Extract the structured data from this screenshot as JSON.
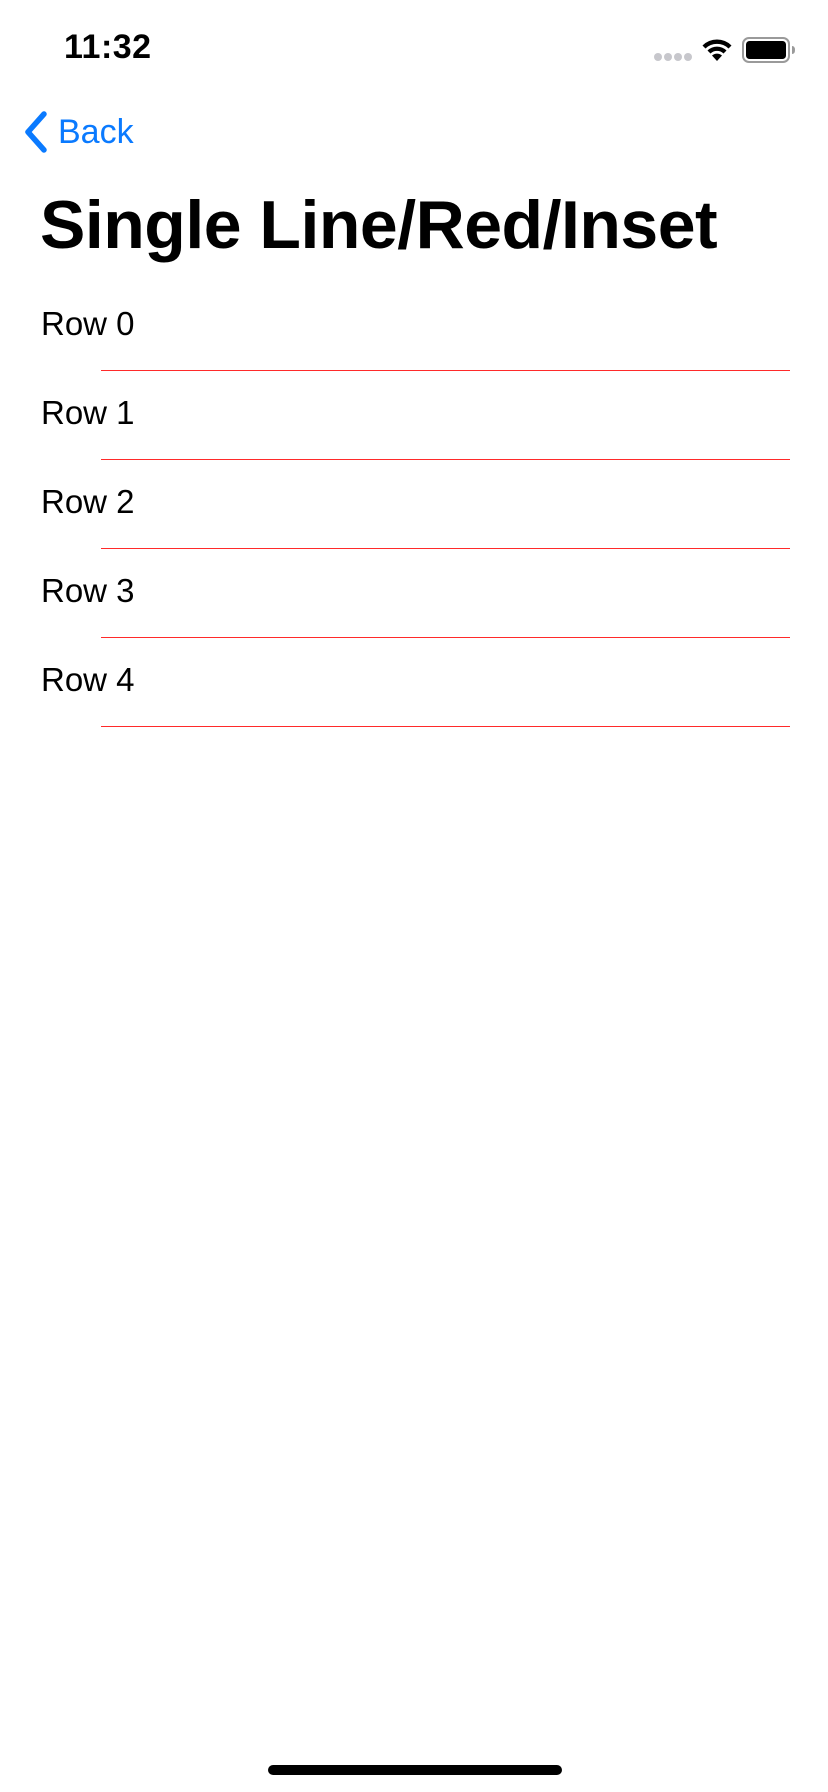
{
  "status_bar": {
    "time": "11:32",
    "icons": [
      "cellular-signal-icon",
      "wifi-icon",
      "battery-icon"
    ]
  },
  "nav": {
    "back_label": "Back",
    "back_icon": "chevron-left-icon",
    "accent_color": "#0a7aff"
  },
  "page": {
    "title": "Single Line/Red/Inset"
  },
  "table": {
    "separator_color": "#ff2a2a",
    "rows": [
      {
        "label": "Row 0"
      },
      {
        "label": "Row 1"
      },
      {
        "label": "Row 2"
      },
      {
        "label": "Row 3"
      },
      {
        "label": "Row 4"
      }
    ]
  }
}
